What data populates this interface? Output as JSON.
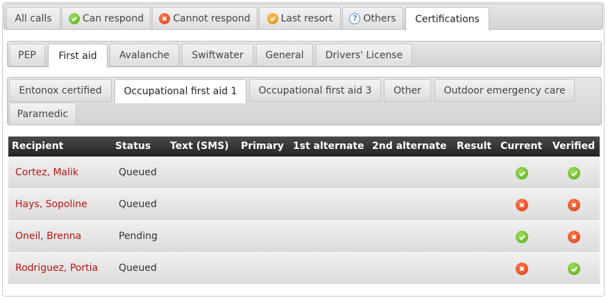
{
  "top_tabs": [
    {
      "label": "All calls",
      "icon": null,
      "active": false
    },
    {
      "label": "Can respond",
      "icon": "check-icon",
      "active": false
    },
    {
      "label": "Cannot respond",
      "icon": "cross-icon",
      "active": false
    },
    {
      "label": "Last resort",
      "icon": "check-orange-icon",
      "active": false
    },
    {
      "label": "Others",
      "icon": "help-icon",
      "active": false
    },
    {
      "label": "Certifications",
      "icon": null,
      "active": true
    }
  ],
  "cert_tabs": [
    {
      "label": "PEP",
      "active": false
    },
    {
      "label": "First aid",
      "active": true
    },
    {
      "label": "Avalanche",
      "active": false
    },
    {
      "label": "Swiftwater",
      "active": false
    },
    {
      "label": "General",
      "active": false
    },
    {
      "label": "Drivers' License",
      "active": false
    }
  ],
  "sub_tabs": [
    {
      "label": "Entonox certified",
      "active": false
    },
    {
      "label": "Occupational first aid 1",
      "active": true
    },
    {
      "label": "Occupational first aid 3",
      "active": false
    },
    {
      "label": "Other",
      "active": false
    },
    {
      "label": "Outdoor emergency care",
      "active": false
    },
    {
      "label": "Paramedic",
      "active": false
    }
  ],
  "table": {
    "columns": [
      "Recipient",
      "Status",
      "Text (SMS)",
      "Primary",
      "1st alternate",
      "2nd alternate",
      "Result",
      "Current",
      "Verified"
    ],
    "rows": [
      {
        "recipient": "Cortez, Malik",
        "status": "Queued",
        "text_sms": "",
        "primary": "",
        "alt1": "",
        "alt2": "",
        "result": "",
        "current": "check",
        "verified": "check"
      },
      {
        "recipient": "Hays, Sopoline",
        "status": "Queued",
        "text_sms": "",
        "primary": "",
        "alt1": "",
        "alt2": "",
        "result": "",
        "current": "cross",
        "verified": "cross"
      },
      {
        "recipient": "Oneil, Brenna",
        "status": "Pending",
        "text_sms": "",
        "primary": "",
        "alt1": "",
        "alt2": "",
        "result": "",
        "current": "check",
        "verified": "cross"
      },
      {
        "recipient": "Rodriguez, Portia",
        "status": "Queued",
        "text_sms": "",
        "primary": "",
        "alt1": "",
        "alt2": "",
        "result": "",
        "current": "cross",
        "verified": "check"
      }
    ]
  },
  "colors": {
    "recipient_link": "#b71414",
    "check": "#56a71b",
    "cross": "#d8401a",
    "last_resort": "#e3890e",
    "help": "#4a8fd6"
  }
}
